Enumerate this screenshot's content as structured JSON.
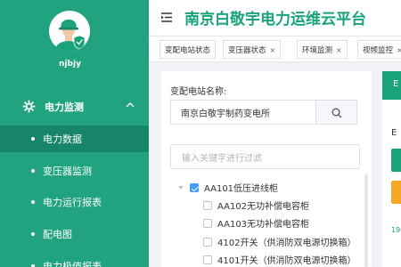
{
  "app": {
    "title": "南京白敬宇电力运维云平台"
  },
  "sidebar": {
    "username": "njbjy",
    "group": {
      "label": "电力监测",
      "icon": "monitor-gear-icon",
      "expanded": true
    },
    "items": [
      {
        "label": "电力数据",
        "active": true
      },
      {
        "label": "变压器监测",
        "active": false
      },
      {
        "label": "电力运行报表",
        "active": false
      },
      {
        "label": "配电图",
        "active": false
      },
      {
        "label": "电力极值报表",
        "active": false
      }
    ]
  },
  "tabs": [
    {
      "label": "变配电站状态",
      "closable": false
    },
    {
      "label": "变压器状态",
      "closable": true,
      "close": "×"
    },
    {
      "label": "环境监测",
      "closable": true,
      "close": "×"
    },
    {
      "label": "视频监控",
      "closable": true,
      "close": "×"
    }
  ],
  "panel": {
    "station_label": "变配电站名称:",
    "station_value": "南京白敬宇制药变电所",
    "filter_placeholder": "输入关键字进行过滤",
    "tree": [
      {
        "label": "AA101低压进线柜",
        "checked": true,
        "level": 0
      },
      {
        "label": "AA102无功补偿电容柜",
        "checked": false,
        "level": 1
      },
      {
        "label": "AA103无功补偿电容柜",
        "checked": false,
        "level": 1
      },
      {
        "label": "4102开关（供消防双电源切换箱）",
        "checked": false,
        "level": 1
      },
      {
        "label": "4101开关（供消防双电源切换箱）",
        "checked": false,
        "level": 1
      }
    ]
  },
  "right_card": {
    "header": "E",
    "text": "E",
    "number": "19"
  },
  "colors": {
    "brand": "#22a37f",
    "brand_dark": "#178567",
    "title": "#1aa37a",
    "accent": "#f5a623",
    "checkbox": "#409eff"
  }
}
